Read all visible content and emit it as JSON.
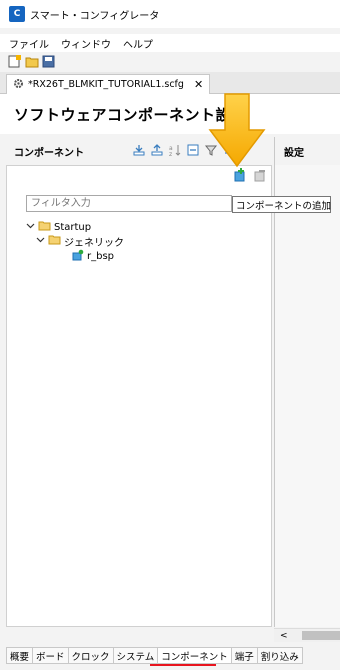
{
  "window": {
    "title": "スマート・コンフィグレータ",
    "app_icon_glyph": "C"
  },
  "menu": [
    "ファイル",
    "ウィンドウ",
    "ヘルプ"
  ],
  "editor_tab": {
    "label": "*RX26T_BLMKIT_TUTORIAL1.scfg",
    "close": "✕"
  },
  "header": {
    "title": "ソフトウェアコンポーネント設定"
  },
  "components_panel": {
    "title": "コンポーネント",
    "filter_placeholder": "フィルタ入力",
    "tooltip": "コンポーネントの追加",
    "tree": [
      {
        "label": "Startup",
        "level": 0,
        "expanded": true,
        "icon": "folder-icon"
      },
      {
        "label": "ジェネリック",
        "level": 1,
        "expanded": true,
        "icon": "folder-icon"
      },
      {
        "label": "r_bsp",
        "level": 2,
        "icon": "component-icon"
      }
    ]
  },
  "settings_panel": {
    "title": "設定"
  },
  "scroll": {
    "left_arrow": "<"
  },
  "bottom_tabs": [
    "概要",
    "ボード",
    "クロック",
    "システム",
    "コンポーネント",
    "端子",
    "割り込み"
  ],
  "active_bottom_tab": "コンポーネント",
  "colors": {
    "accent_arrow": "#f5b400",
    "active_tab_underline": "#e8141e",
    "app_icon": "#1565c0"
  }
}
